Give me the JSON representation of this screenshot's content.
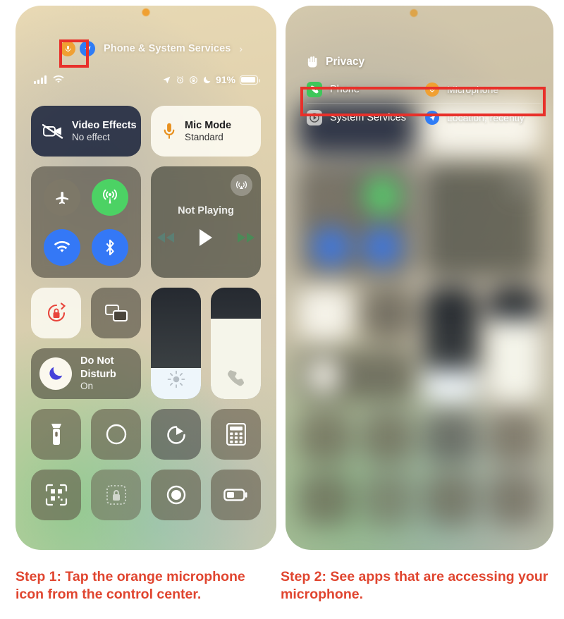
{
  "page": {
    "background": "#ffffff",
    "annotation_color": "#e8302a",
    "caption_color": "#e0452f"
  },
  "left_phone": {
    "name": "control-center-screenshot",
    "privacy_pill": {
      "label": "Phone & System Services",
      "chevron": "›",
      "mic_badge_icon": "microphone-icon",
      "location_badge_icon": "location-arrow-icon"
    },
    "status_bar": {
      "signal_icon": "cellular-bars-icon",
      "wifi_icon": "wifi-icon",
      "location_icon": "location-arrow-icon",
      "alarm_icon": "alarm-clock-icon",
      "orientation_lock_icon": "rotation-lock-icon",
      "dnd_icon": "moon-icon",
      "battery_percent": "91%",
      "battery_icon": "battery-icon",
      "battery_level": 91
    },
    "tiles": {
      "video_effects": {
        "title": "Video Effects",
        "subtitle": "No effect",
        "icon": "video-camera-slash-icon"
      },
      "mic_mode": {
        "title": "Mic Mode",
        "subtitle": "Standard",
        "icon": "microphone-icon"
      },
      "connectivity": {
        "airplane_icon": "airplane-icon",
        "cellular_icon": "cellular-antenna-icon",
        "wifi_icon": "wifi-icon",
        "bluetooth_icon": "bluetooth-icon"
      },
      "media": {
        "status": "Not Playing",
        "airplay_icon": "airplay-audio-icon",
        "rewind_icon": "rewind-icon",
        "play_icon": "play-icon",
        "forward_icon": "fast-forward-icon"
      },
      "orientation_lock": {
        "icon": "rotation-lock-icon"
      },
      "screen_mirroring": {
        "icon": "screen-mirroring-icon"
      },
      "do_not_disturb": {
        "title": "Do Not Disturb",
        "line1": "Do Not",
        "line2": "Disturb",
        "subtitle": "On",
        "icon": "moon-icon"
      },
      "brightness_slider": {
        "icon": "sun-icon",
        "level_percent": 28
      },
      "volume_slider": {
        "icon": "phone-handset-icon",
        "level_percent": 72
      },
      "utilities": [
        {
          "icon": "flashlight-icon"
        },
        {
          "icon": "dark-mode-contrast-icon"
        },
        {
          "icon": "timer-icon"
        },
        {
          "icon": "calculator-icon"
        },
        {
          "icon": "qr-code-scanner-icon"
        },
        {
          "icon": "lock-dotted-icon"
        },
        {
          "icon": "screen-record-icon"
        },
        {
          "icon": "low-power-battery-icon"
        }
      ]
    }
  },
  "right_phone": {
    "name": "privacy-sheet-screenshot",
    "sheet": {
      "header": "Privacy",
      "header_icon": "hand-raised-icon",
      "rows": [
        {
          "app": "Phone",
          "app_icon": "phone-app-icon",
          "service": "Microphone",
          "service_icon": "microphone-icon",
          "highlighted": true
        },
        {
          "app": "System Services",
          "app_icon": "system-services-icon",
          "service": "Location, recently",
          "service_icon": "location-arrow-icon",
          "highlighted": false
        }
      ]
    }
  },
  "captions": {
    "step1": "Step 1: Tap the orange microphone icon from the control center.",
    "step2": "Step 2: See apps that are accessing your microphone."
  }
}
